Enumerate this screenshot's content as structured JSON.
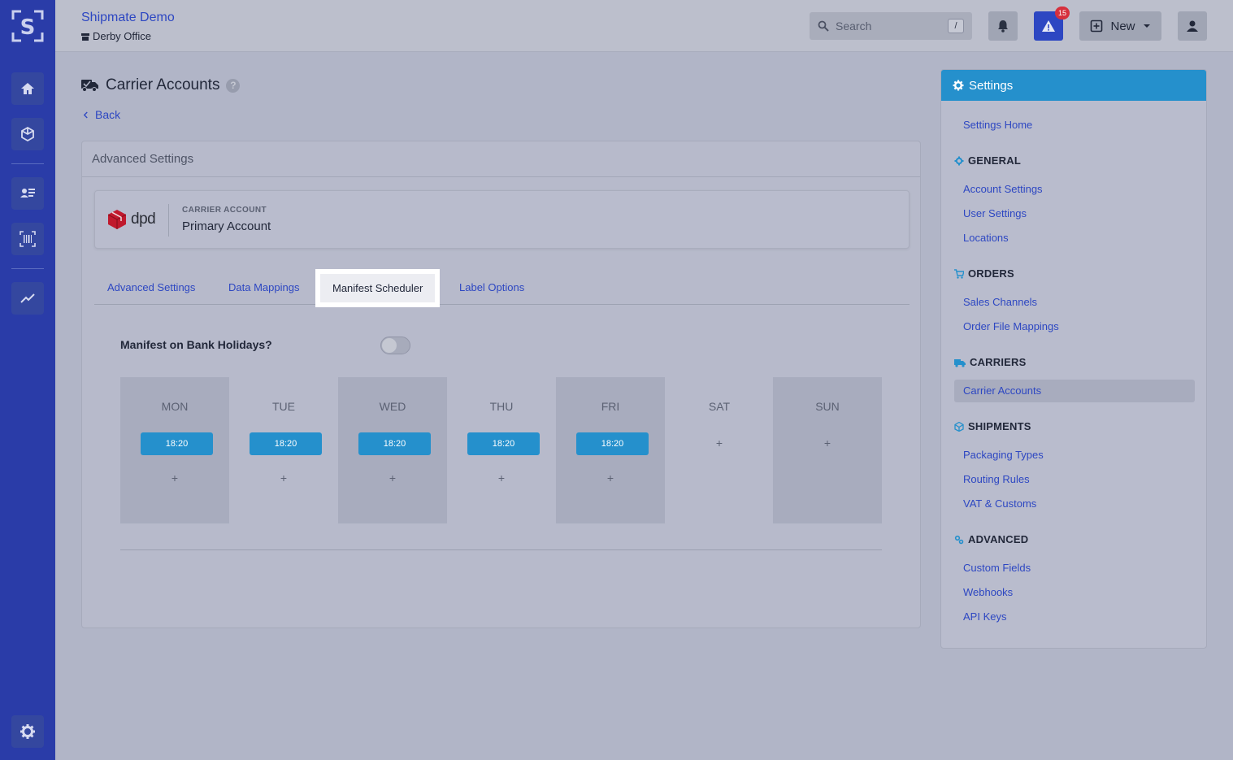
{
  "app": {
    "company": "Shipmate Demo",
    "office": "Derby Office",
    "logo_letter": "S"
  },
  "topbar": {
    "search_placeholder": "Search",
    "search_shortcut": "/",
    "alert_count": "15",
    "new_label": "New"
  },
  "page": {
    "title": "Carrier Accounts",
    "help": "?",
    "back_label": "Back"
  },
  "card": {
    "header": "Advanced Settings",
    "carrier_logo_text": "dpd",
    "carrier_kicker": "CARRIER ACCOUNT",
    "carrier_name": "Primary Account"
  },
  "tabs": [
    {
      "label": "Advanced Settings"
    },
    {
      "label": "Data Mappings"
    },
    {
      "label": "Manifest Scheduler"
    },
    {
      "label": "Label Options"
    }
  ],
  "active_tab": "Manifest Scheduler",
  "scheduler": {
    "bank_holidays_label": "Manifest on Bank Holidays?",
    "bank_holidays_on": false,
    "plus": "+",
    "days": [
      {
        "name": "MON",
        "time": "18:20"
      },
      {
        "name": "TUE",
        "time": "18:20"
      },
      {
        "name": "WED",
        "time": "18:20"
      },
      {
        "name": "THU",
        "time": "18:20"
      },
      {
        "name": "FRI",
        "time": "18:20"
      },
      {
        "name": "SAT",
        "time": ""
      },
      {
        "name": "SUN",
        "time": ""
      }
    ]
  },
  "settings": {
    "title": "Settings",
    "home": "Settings Home",
    "sections": [
      {
        "title": "GENERAL",
        "icon": "gear-icon",
        "items": [
          "Account Settings",
          "User Settings",
          "Locations"
        ]
      },
      {
        "title": "ORDERS",
        "icon": "cart-icon",
        "items": [
          "Sales Channels",
          "Order File Mappings"
        ]
      },
      {
        "title": "CARRIERS",
        "icon": "truck-icon",
        "items": [
          "Carrier Accounts"
        ]
      },
      {
        "title": "SHIPMENTS",
        "icon": "box-icon",
        "items": [
          "Packaging Types",
          "Routing Rules",
          "VAT & Customs"
        ]
      },
      {
        "title": "ADVANCED",
        "icon": "cogs-icon",
        "items": [
          "Custom Fields",
          "Webhooks",
          "API Keys"
        ]
      }
    ],
    "active_item": "Carrier Accounts"
  },
  "colors": {
    "sidebar": "#2a3ca8",
    "accent_blue": "#2590cc",
    "link": "#2d47c2",
    "alert_badge": "#d6303d"
  }
}
